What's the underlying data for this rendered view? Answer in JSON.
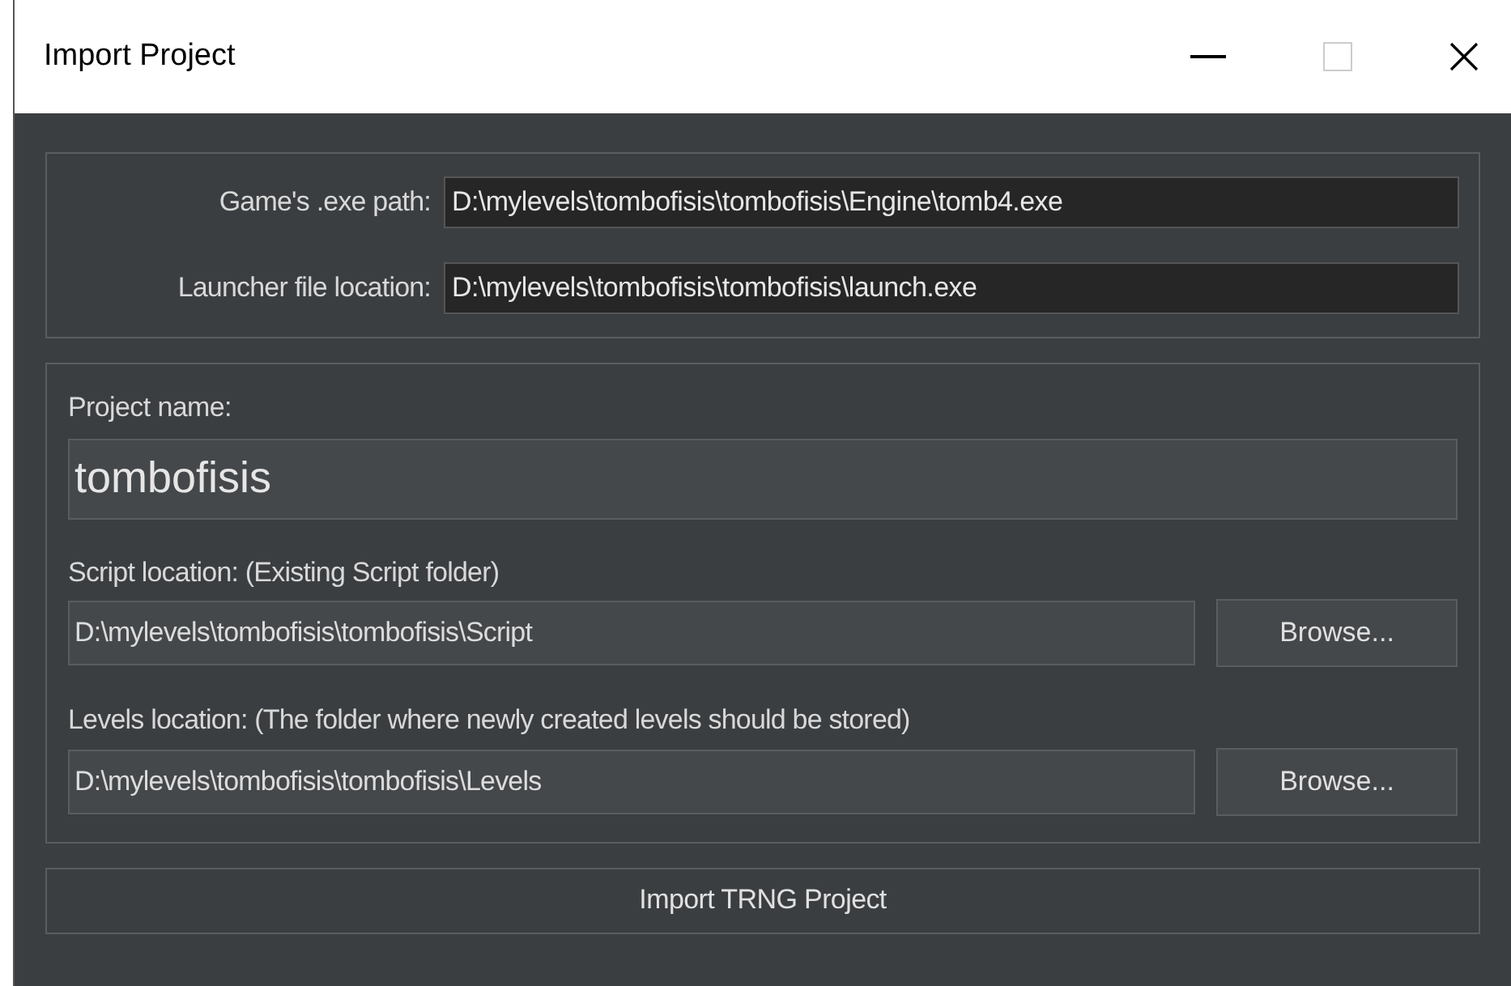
{
  "window": {
    "title": "Import Project"
  },
  "paths": [
    {
      "label": "Game's .exe path:",
      "value": "D:\\mylevels\\tombofisis\\tombofisis\\Engine\\tomb4.exe"
    },
    {
      "label": "Launcher file location:",
      "value": "D:\\mylevels\\tombofisis\\tombofisis\\launch.exe"
    }
  ],
  "project_name": {
    "label": "Project name:",
    "value": "tombofisis"
  },
  "locations": [
    {
      "label": "Script location: (Existing Script folder)",
      "value": "D:\\mylevels\\tombofisis\\tombofisis\\Script",
      "button": "Browse..."
    },
    {
      "label": "Levels location: (The folder where newly created levels should be stored)",
      "value": "D:\\mylevels\\tombofisis\\tombofisis\\Levels",
      "button": "Browse..."
    }
  ],
  "import_button": "Import TRNG Project"
}
